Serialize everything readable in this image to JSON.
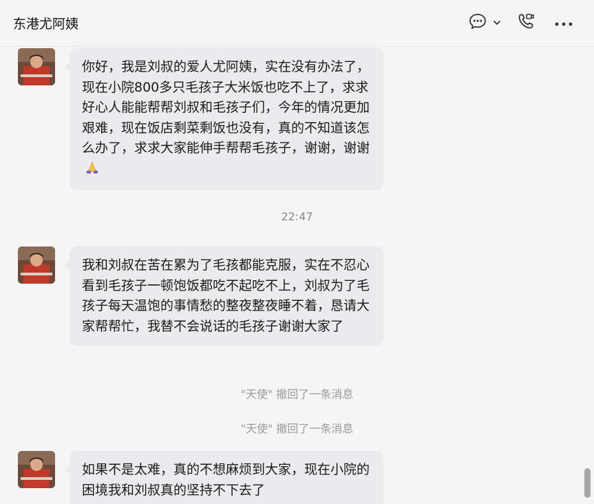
{
  "header": {
    "title": "东港尤阿姨",
    "icons": [
      "chat-bubble-icon",
      "chevron-down-icon",
      "video-call-icon",
      "more-icon"
    ]
  },
  "messages": [
    {
      "text": "你好，我是刘叔的爱人尤阿姨，实在没有办法了，现在小院800多只毛孩子大米饭也吃不上了，求求好心人能能帮帮刘叔和毛孩子们，今年的情况更加艰难，现在饭店剩菜剩饭也没有，真的不知道该怎么办了，求求大家能伸手帮帮毛孩子，谢谢，谢谢",
      "emoji": "folded-hands-emoji"
    },
    {
      "text": "我和刘叔在苦在累为了毛孩都能克服，实在不忍心看到毛孩子一顿饱饭都吃不起吃不上，刘叔为了毛孩子每天温饱的事情愁的整夜整夜睡不着，恳请大家帮帮忙，我替不会说话的毛孩子谢谢大家了"
    },
    {
      "text": "如果不是太难，真的不想麻烦到大家，现在小院的困境我和刘叔真的坚持不下去了"
    }
  ],
  "timestamp": "22:47",
  "system_notices": [
    "\"天使\" 撤回了一条消息",
    "\"天使\" 撤回了一条消息"
  ],
  "colors": {
    "background": "#f5f5f5",
    "bubble": "#ebebed",
    "system_text": "#9a9a9a"
  }
}
